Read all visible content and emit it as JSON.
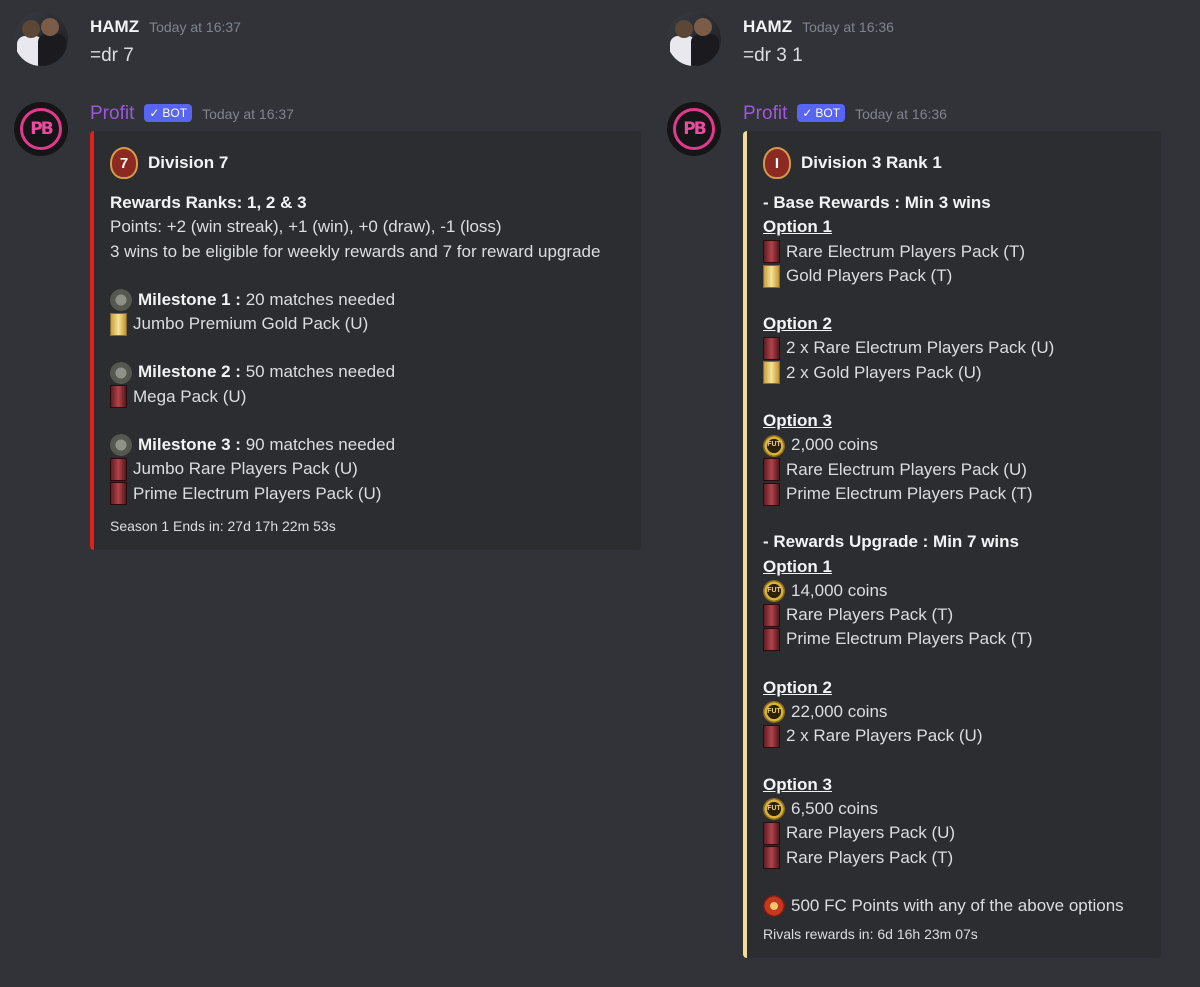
{
  "left": {
    "user_msg": {
      "username": "HAMZ",
      "timestamp": "Today at 16:37",
      "text": "=dr 7"
    },
    "bot_msg": {
      "username": "Profit",
      "badge": "BOT",
      "timestamp": "Today at 16:37",
      "avatar_text": "PB",
      "embed": {
        "accent": "#e0211b",
        "title": "Division 7",
        "title_icon_text": "7",
        "ranks_label": "Rewards Ranks: 1, 2 & 3",
        "points": "Points: +2 (win streak), +1 (win), +0 (draw), -1 (loss)",
        "eligibility": "3 wins to be eligible for weekly rewards and 7 for reward upgrade",
        "milestones": [
          {
            "label": "Milestone 1 :",
            "need": " 20 matches needed",
            "rewards": [
              "Jumbo Premium Gold Pack (U)"
            ]
          },
          {
            "label": "Milestone 2 :",
            "need": " 50 matches needed",
            "rewards": [
              "Mega Pack (U)"
            ]
          },
          {
            "label": "Milestone 3 :",
            "need": " 90 matches needed",
            "rewards": [
              "Jumbo Rare Players Pack (U)",
              "Prime Electrum Players Pack (U)"
            ]
          }
        ],
        "footer": "Season 1 Ends in: 27d 17h 22m 53s"
      }
    }
  },
  "right": {
    "user_msg": {
      "username": "HAMZ",
      "timestamp": "Today at 16:36",
      "text": "=dr 3 1"
    },
    "bot_msg": {
      "username": "Profit",
      "badge": "BOT",
      "timestamp": "Today at 16:36",
      "avatar_text": "PB",
      "embed": {
        "accent": "#f2dc9b",
        "title": "Division 3 Rank 1",
        "title_icon_text": "I",
        "base_heading": "- Base Rewards : Min 3 wins",
        "base_options": [
          {
            "label": "Option 1",
            "items": [
              "Rare Electrum Players Pack (T)",
              "Gold Players Pack (T)"
            ]
          },
          {
            "label": "Option 2",
            "items": [
              "2 x Rare Electrum Players Pack (U)",
              "2 x Gold Players Pack (U)"
            ]
          },
          {
            "label": "Option 3",
            "items": [
              "2,000 coins",
              "Rare Electrum Players Pack (U)",
              "Prime Electrum Players Pack (T)"
            ]
          }
        ],
        "upgrade_heading": "- Rewards Upgrade : Min 7 wins",
        "upgrade_options": [
          {
            "label": "Option 1",
            "items": [
              "14,000 coins",
              "Rare Players Pack (T)",
              "Prime Electrum Players Pack (T)"
            ]
          },
          {
            "label": "Option 2",
            "items": [
              "22,000 coins",
              "2 x Rare Players Pack (U)"
            ]
          },
          {
            "label": "Option 3",
            "items": [
              "6,500 coins",
              "Rare Players Pack (U)",
              "Rare Players Pack (T)"
            ]
          }
        ],
        "fc_points": "500 FC Points with any of the above options",
        "footer": "Rivals rewards in: 6d 16h 23m 07s"
      }
    }
  },
  "icons": {
    "coin_text": "FUT"
  }
}
